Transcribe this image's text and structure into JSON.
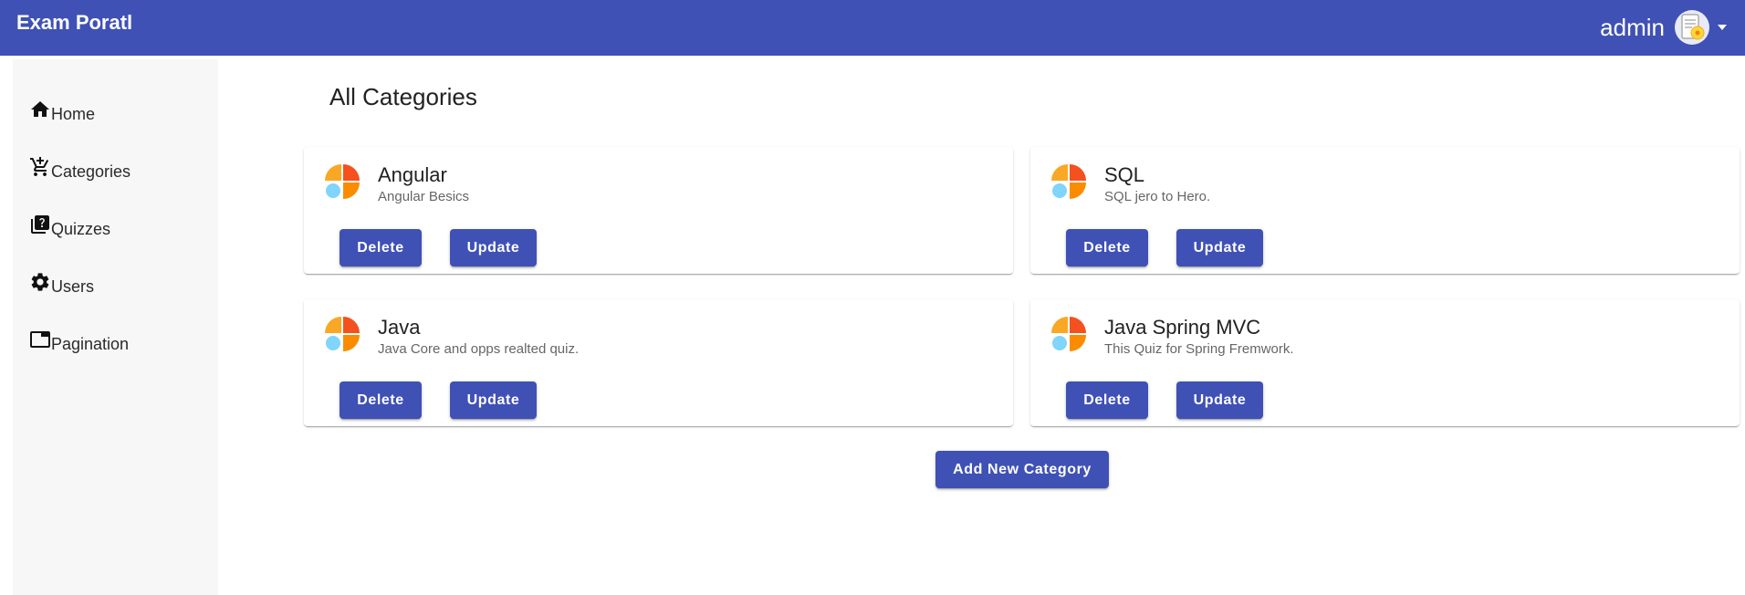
{
  "header": {
    "brand": "Exam Poratl",
    "username": "admin",
    "avatar_icon": "user-avatar-icon",
    "caret_icon": "caret-down-icon"
  },
  "sidebar": {
    "items": [
      {
        "label": "Home",
        "icon": "home-icon"
      },
      {
        "label": "Categories",
        "icon": "add-shopping-cart-icon"
      },
      {
        "label": "Quizzes",
        "icon": "quiz-icon"
      },
      {
        "label": "Users",
        "icon": "gear-icon"
      },
      {
        "label": "Pagination",
        "icon": "tab-icon"
      }
    ]
  },
  "main": {
    "title": "All Categories",
    "categories": [
      {
        "title": "Angular",
        "description": "Angular Besics",
        "delete_label": "Delete",
        "update_label": "Update"
      },
      {
        "title": "SQL",
        "description": "SQL jero to Hero.",
        "delete_label": "Delete",
        "update_label": "Update"
      },
      {
        "title": "Java",
        "description": "Java Core and opps realted quiz.",
        "delete_label": "Delete",
        "update_label": "Update"
      },
      {
        "title": "Java Spring MVC",
        "description": "This Quiz for Spring Fremwork.",
        "delete_label": "Delete",
        "update_label": "Update"
      }
    ],
    "add_button_label": "Add New Category"
  },
  "colors": {
    "primary": "#3f51b5",
    "sidebar_bg": "#f7f7f7",
    "icon_yellow": "#f9a825",
    "icon_orange": "#f4511e",
    "icon_light_orange": "#fb8c00",
    "icon_blue": "#81d4fa"
  }
}
